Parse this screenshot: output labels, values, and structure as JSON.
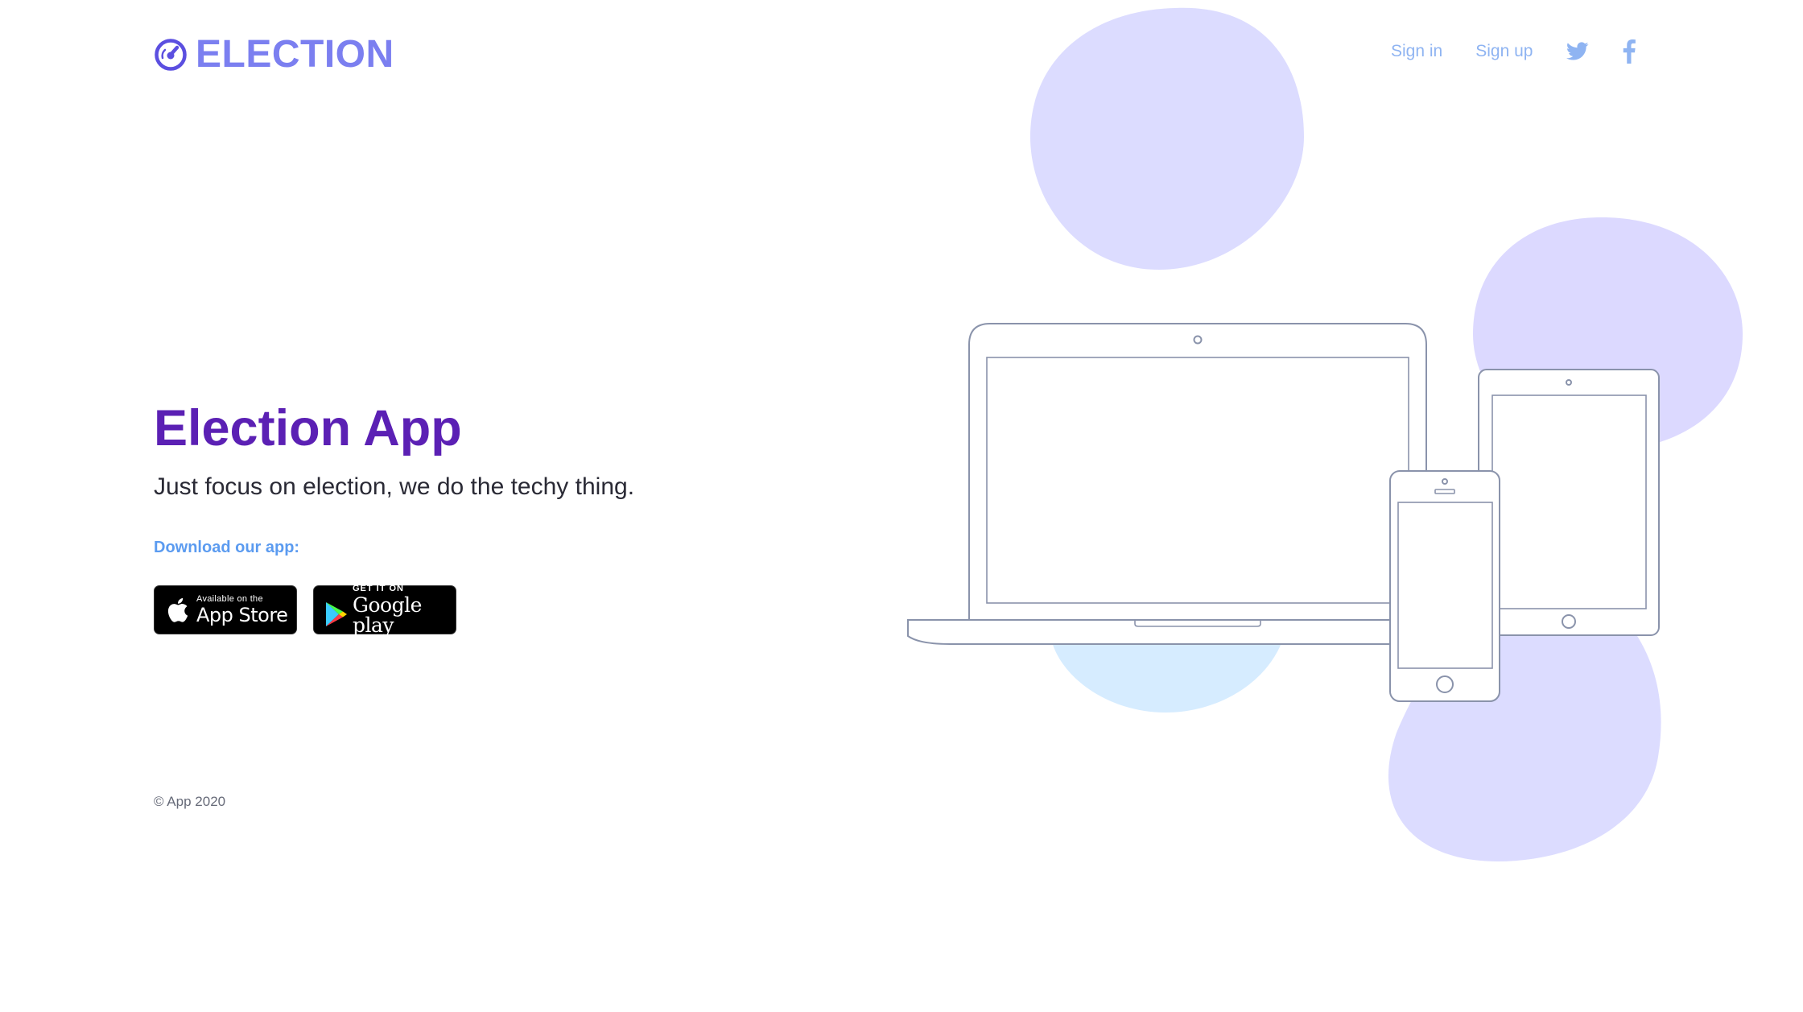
{
  "header": {
    "brand_name": "ELECTION",
    "nav": {
      "sign_in": "Sign in",
      "sign_up": "Sign up"
    }
  },
  "hero": {
    "title": "Election App",
    "subtitle": "Just focus on election, we do the techy thing.",
    "download_label": "Download our app:",
    "app_store": {
      "small": "Available on the",
      "big": "App Store"
    },
    "google_play": {
      "small": "GET IT ON",
      "big": "Google play"
    }
  },
  "footer": {
    "copyright": "© App 2020"
  },
  "colors": {
    "brand": "#7b7ff0",
    "title": "#5b20b4",
    "link": "#8fb4f2",
    "accent": "#5b9bf0",
    "blob_purple": "#dcdcff",
    "blob_blue": "#d6ecff",
    "device_stroke": "#8a93ab"
  },
  "icons": {
    "logo": "gauge-icon",
    "twitter": "twitter-icon",
    "facebook": "facebook-icon",
    "apple": "apple-icon",
    "google_play": "google-play-icon"
  }
}
